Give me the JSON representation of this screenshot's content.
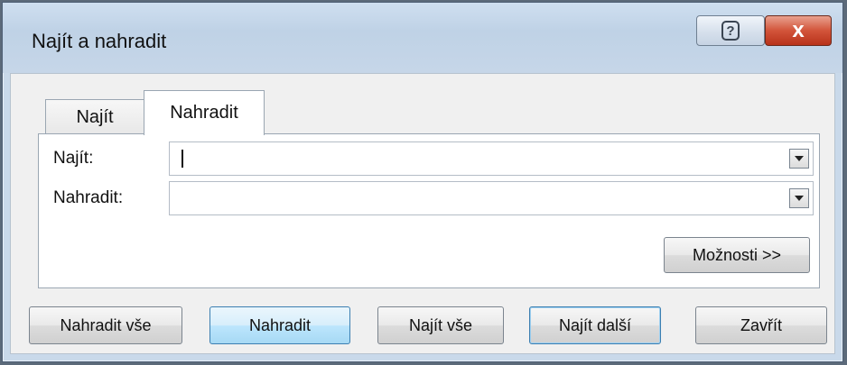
{
  "window": {
    "title": "Najít a nahradit",
    "help_label": "?",
    "close_label": "x"
  },
  "tabs": [
    {
      "label": "Najít",
      "selected": false
    },
    {
      "label": "Nahradit",
      "selected": true
    }
  ],
  "fields": {
    "find_label": "Najít:",
    "find_value": "",
    "replace_label": "Nahradit:",
    "replace_value": ""
  },
  "options_button": "Možnosti >>",
  "buttons": {
    "replace_all": "Nahradit vše",
    "replace": "Nahradit",
    "find_all": "Najít vše",
    "find_next": "Najít další",
    "close": "Zavřít"
  }
}
